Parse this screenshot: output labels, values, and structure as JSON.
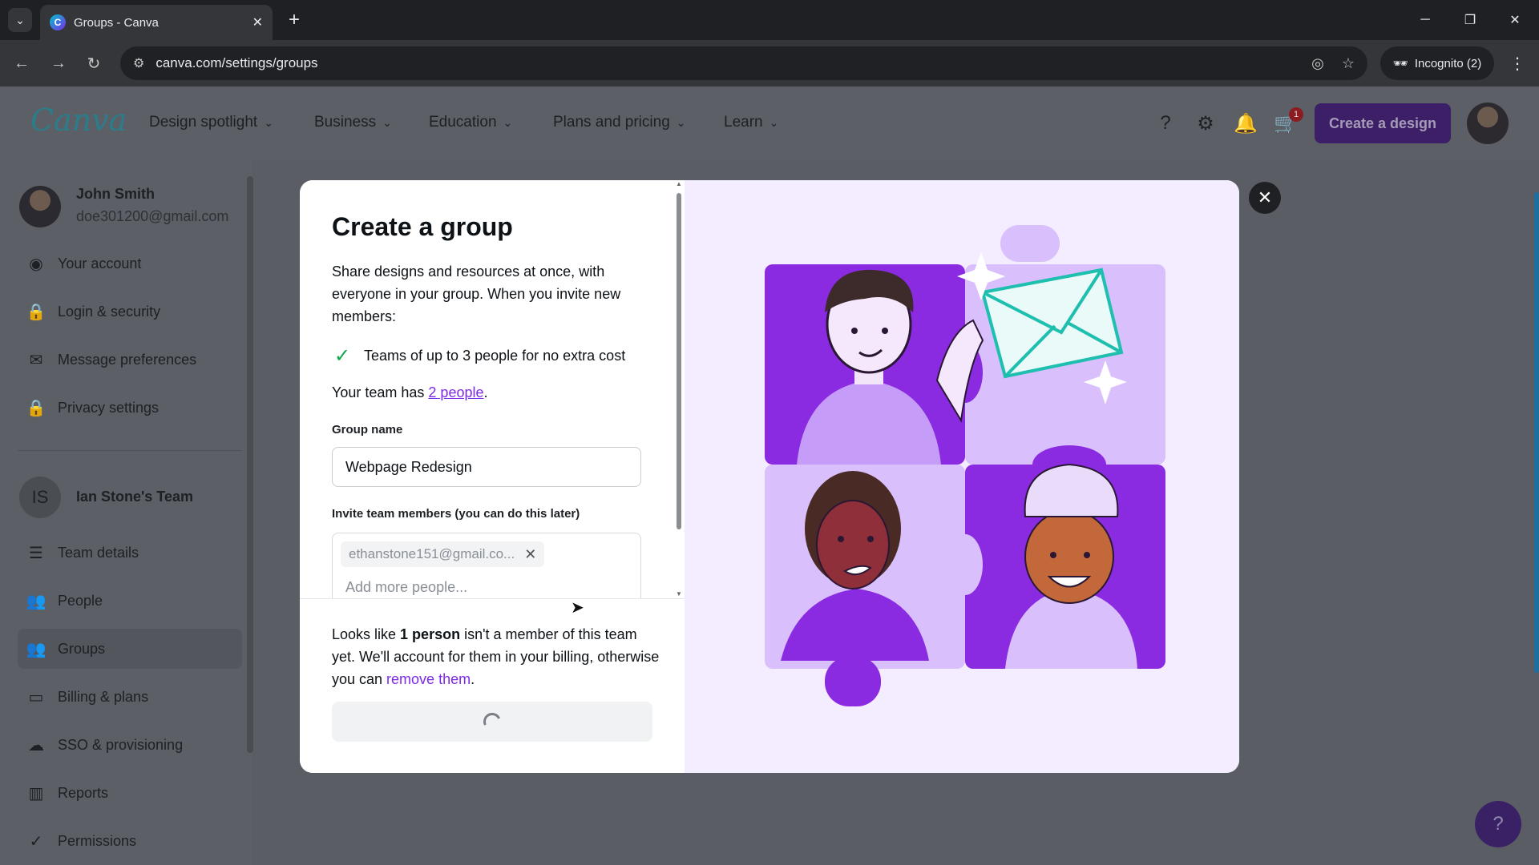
{
  "browser": {
    "tab_title": "Groups - Canva",
    "url": "canva.com/settings/groups",
    "incognito_label": "Incognito (2)"
  },
  "header": {
    "logo": "Canva",
    "nav": [
      "Design spotlight",
      "Business",
      "Education",
      "Plans and pricing",
      "Learn"
    ],
    "cart_badge": "1",
    "create_button": "Create a design"
  },
  "sidebar": {
    "user_name": "John Smith",
    "user_email": "doe301200@gmail.com",
    "account_items": [
      "Your account",
      "Login & security",
      "Message preferences",
      "Privacy settings"
    ],
    "team_initials": "IS",
    "team_name": "Ian Stone's Team",
    "team_items": [
      "Team details",
      "People",
      "Groups",
      "Billing & plans",
      "SSO & provisioning",
      "Reports",
      "Permissions"
    ],
    "active_item": "Groups"
  },
  "modal": {
    "title": "Create a group",
    "description": "Share designs and resources at once, with everyone in your group. When you invite new members:",
    "benefit": "Teams of up to 3 people for no extra cost",
    "team_count_prefix": "Your team has ",
    "team_count_link": "2 people",
    "team_count_suffix": ".",
    "group_name_label": "Group name",
    "group_name_value": "Webpage Redesign",
    "invite_label": "Invite team members (you can do this later)",
    "invite_chip": "ethanstone151@gmail.co...",
    "invite_placeholder": "Add more people...",
    "notice_prefix": "Looks like ",
    "notice_bold": "1 person",
    "notice_middle": " isn't a member of this team yet. We'll account for them in your billing, otherwise you can ",
    "notice_link": "remove them",
    "notice_suffix": "."
  },
  "colors": {
    "accent_purple": "#7d2ae8",
    "check_green": "#0ba84a",
    "illustration_bg": "#f4ecff"
  },
  "icons": {
    "help_fab": "?"
  }
}
